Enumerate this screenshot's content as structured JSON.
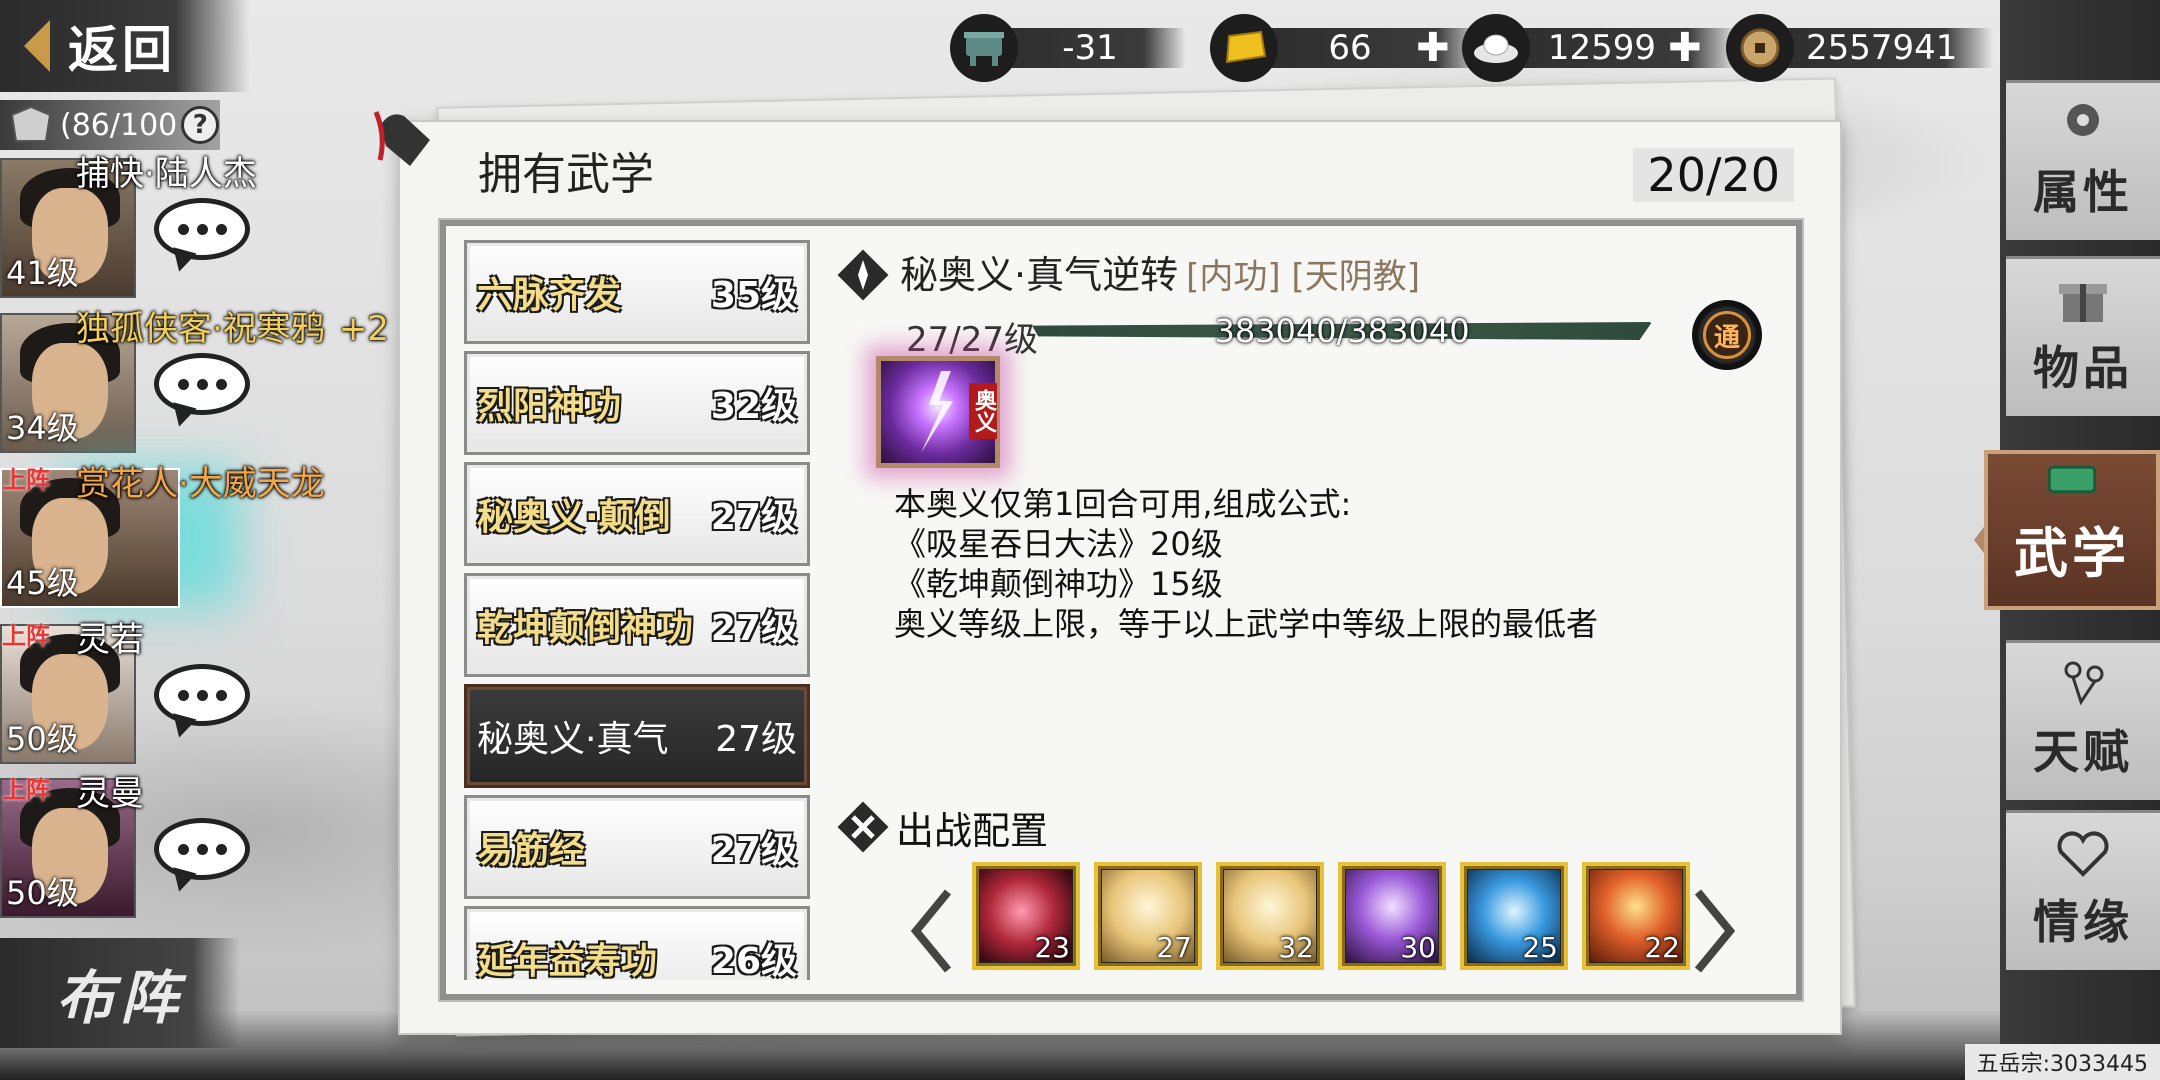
{
  "back": {
    "label": "返回"
  },
  "currencies": [
    {
      "icon": "bronze-vessel-icon",
      "value": "-31",
      "plus": false
    },
    {
      "icon": "gold-bar-icon",
      "value": "66",
      "plus": true
    },
    {
      "icon": "silver-ingot-icon",
      "value": "12599",
      "plus": true
    },
    {
      "icon": "copper-coin-icon",
      "value": "2557941",
      "plus": false
    }
  ],
  "roster": {
    "count": "(86/100",
    "help": "?",
    "heroes": [
      {
        "name": "捕快·陆人杰",
        "level": "41级",
        "on_team": "",
        "extra": "",
        "color": "white"
      },
      {
        "name": "独孤侠客·祝寒鸦",
        "level": "34级",
        "on_team": "",
        "extra": "+2",
        "color": "gold"
      },
      {
        "name": "赏花人·大威天龙",
        "level": "45级",
        "on_team": "上阵",
        "extra": "",
        "color": "orange"
      },
      {
        "name": "灵若",
        "level": "50级",
        "on_team": "上阵",
        "extra": "",
        "color": "white"
      },
      {
        "name": "灵曼",
        "level": "50级",
        "on_team": "上阵",
        "extra": "",
        "color": "white"
      }
    ],
    "formation_label": "布阵"
  },
  "panel": {
    "title": "拥有武学",
    "count": "20/20",
    "skills": [
      {
        "name": "六脉齐发",
        "level": "35级"
      },
      {
        "name": "烈阳神功",
        "level": "32级"
      },
      {
        "name": "秘奥义·颠倒",
        "level": "27级"
      },
      {
        "name": "乾坤颠倒神功",
        "level": "27级"
      },
      {
        "name": "秘奥义·真气",
        "level": "27级"
      },
      {
        "name": "易筋经",
        "level": "27级"
      },
      {
        "name": "延年益寿功",
        "level": "26级"
      }
    ],
    "selected_index": 4,
    "detail": {
      "title": "秘奥义·真气逆转",
      "tags": "[内功] [天阴教]",
      "level": "27/27级",
      "exp": "383040/383040",
      "exp_fraction": 1.0,
      "badge": "通",
      "icon_tag": "奥义",
      "description": [
        "本奥义仅第1回合可用,组成公式:",
        "《吸星吞日大法》20级",
        "《乾坤颠倒神功》15级",
        "奥义等级上限，等于以上武学中等级上限的最低者"
      ]
    },
    "battle": {
      "title": "出战配置",
      "slots": [
        {
          "level": "23",
          "art": "red-orb-icon",
          "color": "#b0283a"
        },
        {
          "level": "27",
          "art": "meditating-figure-icon",
          "color": "#c79a3a"
        },
        {
          "level": "32",
          "art": "meditating-figure-icon",
          "color": "#c79a3a"
        },
        {
          "level": "30",
          "art": "purple-fist-icon",
          "color": "#7b3fb8"
        },
        {
          "level": "25",
          "art": "blue-aura-icon",
          "color": "#2a7bd0"
        },
        {
          "level": "22",
          "art": "fire-figure-icon",
          "color": "#d0581e"
        }
      ]
    }
  },
  "nav": [
    {
      "label": "属性",
      "icon": "flower-icon"
    },
    {
      "label": "物品",
      "icon": "gift-box-icon"
    },
    {
      "label": "武学",
      "icon": "jade-book-icon",
      "active": true
    },
    {
      "label": "天赋",
      "icon": "branch-icon"
    },
    {
      "label": "情缘",
      "icon": "heart-knot-icon"
    }
  ],
  "server": "五岳宗:3033445"
}
